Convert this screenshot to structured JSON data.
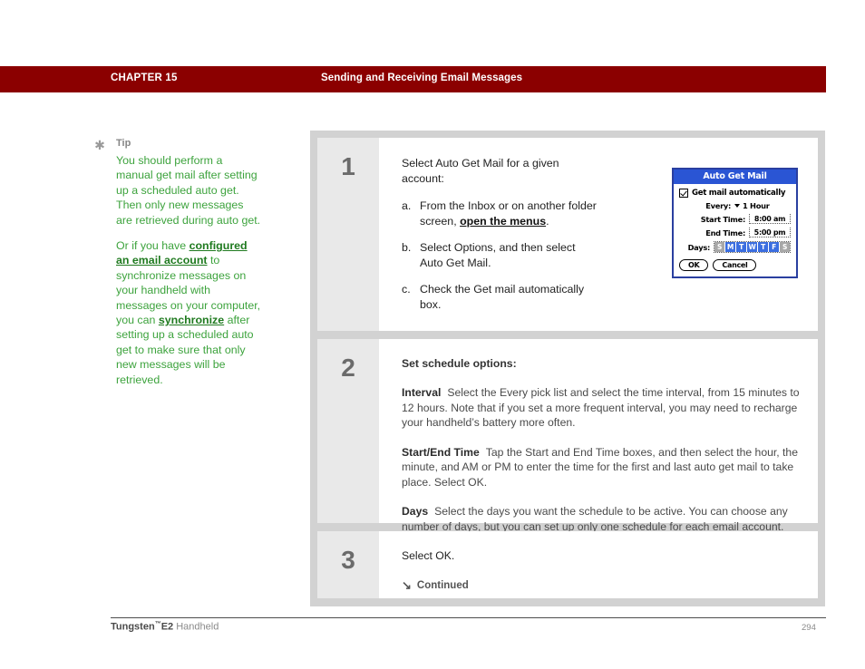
{
  "header": {
    "chapter": "CHAPTER 15",
    "title": "Sending and Receiving Email Messages",
    "bar_color": "#8b0000"
  },
  "tip": {
    "star_icon": "asterisk-icon",
    "label": "Tip",
    "paragraph1_part1": "You should perform a manual get mail after setting up a scheduled auto get. Then only new messages are retrieved during auto get.",
    "paragraph2_pre": "Or if you have ",
    "paragraph2_link1": "configured an email account",
    "paragraph2_mid": " to synchronize messages on your handheld with messages on your computer, you can ",
    "paragraph2_link2": "synchronize",
    "paragraph2_post": " after setting up a scheduled auto get to make sure that only new messages will be retrieved.",
    "text_color": "#3da33d",
    "link_color": "#1f7a1f"
  },
  "steps": [
    {
      "number": "1",
      "lead": "Select Auto Get Mail for a given account:",
      "items": [
        {
          "marker": "a.",
          "text_pre": "From the Inbox or on another folder screen, ",
          "link": "open the menus",
          "text_post": "."
        },
        {
          "marker": "b.",
          "text_pre": "Select Options, and then select Auto Get Mail.",
          "link": "",
          "text_post": ""
        },
        {
          "marker": "c.",
          "text_pre": "Check the Get mail automatically box.",
          "link": "",
          "text_post": ""
        }
      ]
    },
    {
      "number": "2",
      "lead": "Set schedule options:",
      "paragraphs": [
        {
          "term": "Interval",
          "body": "Select the Every pick list and select the time interval, from 15 minutes to 12 hours. Note that if you set a more frequent interval, you may need to recharge your handheld’s battery more often."
        },
        {
          "term": "Start/End Time",
          "body": "Tap the Start and End Time boxes, and then select the hour, the minute, and AM or PM to enter the time for the first and last auto get mail to take place. Select OK."
        },
        {
          "term": "Days",
          "body": "Select the days you want the schedule to be active. You can choose any number of days, but you can set up only one schedule for each email account."
        }
      ]
    },
    {
      "number": "3",
      "lead": "Select OK.",
      "continued_icon": "arrow-down-right-icon",
      "continued_label": "Continued"
    }
  ],
  "dialog": {
    "title": "Auto Get Mail",
    "checkbox": {
      "icon": "checkbox-checked-icon",
      "label": "Get mail automatically",
      "checked": true
    },
    "rows": [
      {
        "label": "Every:",
        "value": "1 Hour",
        "type": "picklist"
      },
      {
        "label": "Start Time:",
        "value": "8:00 am",
        "type": "field"
      },
      {
        "label": "End Time:",
        "value": "5:00 pm",
        "type": "field"
      }
    ],
    "days_label": "Days:",
    "days": [
      {
        "letter": "S",
        "selected": false
      },
      {
        "letter": "M",
        "selected": true
      },
      {
        "letter": "T",
        "selected": true
      },
      {
        "letter": "W",
        "selected": true
      },
      {
        "letter": "T",
        "selected": true
      },
      {
        "letter": "F",
        "selected": true
      },
      {
        "letter": "S",
        "selected": false
      }
    ],
    "ok_label": "OK",
    "cancel_label": "Cancel",
    "title_color": "#2a55d4",
    "day_selected_color": "#3b6ee0",
    "day_unselected_color": "#a8a8a8"
  },
  "footer": {
    "product": "Tungsten",
    "trademark": "™",
    "model": "E2",
    "device": " Handheld",
    "page": "294"
  }
}
